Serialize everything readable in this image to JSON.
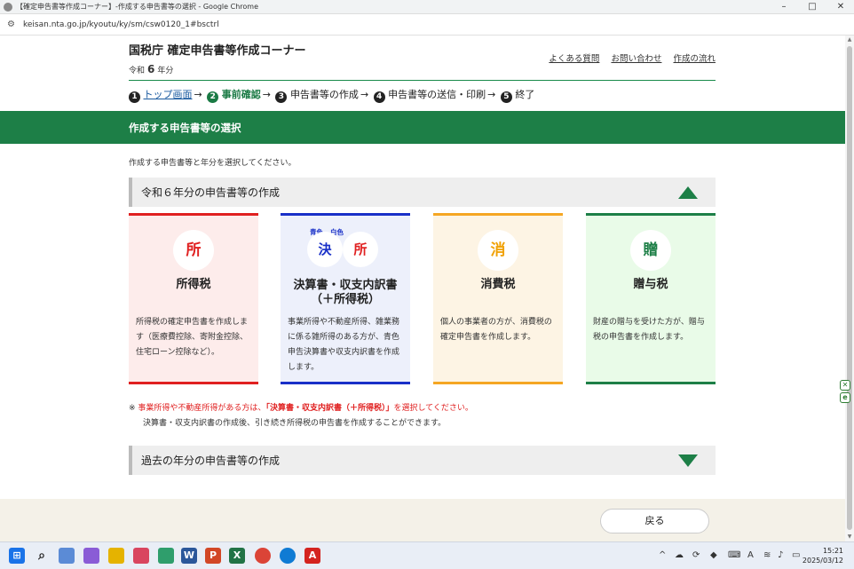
{
  "window": {
    "title": "【確定申告書等作成コーナー】-作成する申告書等の選択 - Google Chrome",
    "minimize": "–",
    "maximize": "□",
    "close": "✕"
  },
  "address": {
    "url": "keisan.nta.go.jp/kyoutu/ky/sm/csw0120_1#bsctrl"
  },
  "header": {
    "site_title": "国税庁 確定申告書等作成コーナー",
    "era_prefix": "令和",
    "era_year": "6",
    "era_suffix": "年分",
    "links": [
      "よくある質問",
      "お問い合わせ",
      "作成の流れ"
    ]
  },
  "steps": [
    {
      "num": "1",
      "label": "トップ画面",
      "state": "link"
    },
    {
      "num": "2",
      "label": "事前確認",
      "state": "current"
    },
    {
      "num": "3",
      "label": "申告書等の作成",
      "state": "normal"
    },
    {
      "num": "4",
      "label": "申告書等の送信・印刷",
      "state": "normal"
    },
    {
      "num": "5",
      "label": "終了",
      "state": "normal"
    }
  ],
  "section_heading": "作成する申告書等の選択",
  "intro": "作成する申告書等と年分を選択してください。",
  "accordion_current": {
    "label": "令和６年分の申告書等の作成"
  },
  "accordion_past": {
    "label": "過去の年分の申告書等の作成"
  },
  "cards": [
    {
      "icon": "所",
      "title": "所得税",
      "desc": "所得税の確定申告書を作成します（医療費控除、寄附金控除、住宅ローン控除など）。",
      "color": "#e02020"
    },
    {
      "icon_a": "決",
      "icon_b": "所",
      "cap_a": "青色",
      "cap_b": "白色",
      "title": "決算書・収支内訳書",
      "title2": "（＋所得税）",
      "desc": "事業所得や不動産所得、雑業務に係る雑所得のある方が、青色申告決算書や収支内訳書を作成します。",
      "color": "#1930c8"
    },
    {
      "icon": "消",
      "title": "消費税",
      "desc": "個人の事業者の方が、消費税の確定申告書を作成します。",
      "color": "#f5a623"
    },
    {
      "icon": "贈",
      "title": "贈与税",
      "desc": "財産の贈与を受けた方が、贈与税の申告書を作成します。",
      "color": "#1d7f47"
    }
  ],
  "note": {
    "mark": "※",
    "line1_a": "事業所得や不動産所得がある方は、",
    "line1_b": "「決算書・収支内訳書（＋所得税）」",
    "line1_c": "を選択してください。",
    "line2": "決算書・収支内訳書の作成後、引き続き所得税の申告書を作成することができます。"
  },
  "back_button": "戻る",
  "taskbar": {
    "time": "15:21",
    "date": "2025/03/12",
    "ime": "A"
  }
}
